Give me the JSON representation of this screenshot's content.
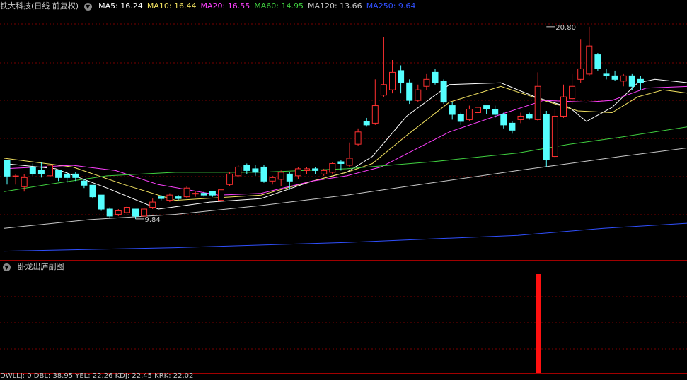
{
  "header": {
    "stock_title": "铁大科技(日线 前复权)",
    "ma": [
      {
        "label": "MA5: ",
        "value": "16.24",
        "color": "#ffffff"
      },
      {
        "label": "MA10: ",
        "value": "16.44",
        "color": "#f0e060"
      },
      {
        "label": "MA20: ",
        "value": "16.55",
        "color": "#ff40ff"
      },
      {
        "label": "MA60: ",
        "value": "14.95",
        "color": "#40d040"
      },
      {
        "label": "MA120: ",
        "value": "13.66",
        "color": "#c8c8c8"
      },
      {
        "label": "MA250: ",
        "value": "9.64",
        "color": "#3050ff"
      }
    ]
  },
  "sub_panel": {
    "title": "卧龙出庐副图",
    "bottom_text": "DWLLJ: 0  DBL: 38.95  YEL: 22.26  KDJ: 22.45  KRK: 22.02"
  },
  "colors": {
    "up": "#ff3030",
    "down": "#54ffff",
    "grid": "#7a0000",
    "signal": "#ff1010"
  },
  "chart_data": {
    "type": "candlestick",
    "price_range": [
      7.5,
      21.6
    ],
    "annotations": [
      {
        "text": "20.80",
        "value": 20.8,
        "bar": 63
      },
      {
        "text": "9.84",
        "value": 9.84,
        "bar": 15
      }
    ],
    "candles": [
      [
        13.2,
        12.28,
        13.2,
        11.8
      ],
      [
        12.28,
        12.29,
        12.4,
        11.8
      ],
      [
        11.68,
        12.2,
        12.4,
        11.4
      ],
      [
        12.8,
        12.4,
        13.0,
        12.3
      ],
      [
        12.6,
        12.4,
        13.1,
        12.2
      ],
      [
        12.3,
        12.9,
        12.9,
        12.2
      ],
      [
        12.6,
        12.2,
        12.6,
        12.0
      ],
      [
        12.4,
        12.2,
        12.5,
        11.9
      ],
      [
        12.4,
        12.2,
        12.5,
        12.0
      ],
      [
        12.0,
        11.76,
        12.1,
        11.6
      ],
      [
        11.76,
        11.1,
        11.76,
        11.0
      ],
      [
        11.2,
        10.4,
        11.2,
        10.3
      ],
      [
        10.4,
        10.0,
        10.5,
        9.9
      ],
      [
        10.1,
        10.3,
        10.4,
        10.0
      ],
      [
        10.2,
        10.5,
        10.6,
        10.1
      ],
      [
        10.4,
        10.0,
        10.4,
        9.84
      ],
      [
        10.0,
        10.4,
        10.5,
        10.0
      ],
      [
        10.5,
        10.8,
        11.0,
        10.4
      ],
      [
        11.1,
        11.0,
        11.2,
        10.9
      ],
      [
        10.9,
        11.2,
        11.3,
        10.8
      ],
      [
        11.1,
        11.0,
        11.2,
        10.9
      ],
      [
        11.1,
        11.6,
        11.7,
        11.0
      ],
      [
        11.3,
        11.3,
        11.4,
        11.1
      ],
      [
        11.3,
        11.2,
        11.4,
        11.1
      ],
      [
        11.4,
        11.2,
        11.4,
        11.1
      ],
      [
        10.9,
        11.5,
        11.6,
        10.8
      ],
      [
        11.8,
        12.4,
        12.5,
        11.7
      ],
      [
        12.3,
        12.8,
        12.9,
        12.2
      ],
      [
        12.9,
        12.6,
        13.0,
        12.4
      ],
      [
        12.7,
        12.5,
        12.9,
        12.3
      ],
      [
        12.8,
        12.0,
        12.9,
        11.9
      ],
      [
        12.0,
        12.2,
        12.3,
        11.8
      ],
      [
        12.1,
        12.5,
        12.6,
        11.7
      ],
      [
        12.4,
        12.0,
        12.5,
        11.5
      ],
      [
        12.3,
        12.7,
        12.8,
        12.1
      ],
      [
        12.6,
        12.7,
        12.8,
        12.4
      ],
      [
        12.7,
        12.6,
        12.8,
        12.4
      ],
      [
        12.4,
        12.6,
        12.7,
        12.3
      ],
      [
        12.5,
        13.0,
        13.1,
        12.4
      ],
      [
        13.1,
        13.0,
        13.2,
        12.6
      ],
      [
        12.9,
        13.3,
        14.2,
        12.8
      ],
      [
        14.1,
        14.8,
        15.0,
        14.0
      ],
      [
        15.4,
        15.2,
        15.6,
        15.1
      ],
      [
        15.3,
        16.3,
        17.8,
        15.2
      ],
      [
        16.9,
        17.5,
        20.2,
        16.8
      ],
      [
        17.2,
        18.2,
        18.9,
        17.0
      ],
      [
        18.3,
        17.6,
        18.6,
        17.0
      ],
      [
        17.6,
        16.6,
        17.8,
        16.4
      ],
      [
        16.6,
        17.2,
        17.5,
        16.5
      ],
      [
        17.4,
        17.8,
        18.1,
        17.2
      ],
      [
        18.2,
        17.6,
        18.4,
        17.5
      ],
      [
        17.7,
        16.5,
        17.8,
        16.4
      ],
      [
        16.3,
        15.8,
        16.5,
        15.5
      ],
      [
        15.8,
        15.4,
        15.9,
        15.2
      ],
      [
        15.5,
        16.1,
        16.3,
        15.4
      ],
      [
        15.9,
        16.2,
        16.3,
        15.7
      ],
      [
        16.3,
        16.1,
        16.3,
        15.8
      ],
      [
        16.1,
        15.8,
        16.3,
        15.6
      ],
      [
        15.8,
        15.2,
        15.9,
        15.0
      ],
      [
        15.3,
        14.9,
        15.4,
        14.7
      ],
      [
        15.5,
        15.7,
        15.9,
        15.3
      ],
      [
        15.8,
        15.6,
        15.9,
        15.5
      ],
      [
        15.5,
        17.4,
        18.2,
        15.4
      ],
      [
        15.8,
        13.2,
        16.0,
        12.8
      ],
      [
        13.4,
        15.7,
        16.1,
        13.3
      ],
      [
        15.7,
        16.8,
        17.5,
        15.6
      ],
      [
        16.7,
        17.4,
        18.1,
        16.4
      ],
      [
        17.8,
        18.4,
        20.1,
        17.6
      ],
      [
        18.1,
        19.7,
        20.8,
        18.0
      ],
      [
        19.2,
        18.4,
        19.3,
        18.3
      ],
      [
        18.1,
        18.0,
        18.4,
        17.8
      ],
      [
        18.0,
        17.8,
        18.3,
        17.7
      ],
      [
        17.7,
        18.0,
        18.1,
        17.4
      ],
      [
        18.0,
        17.4,
        18.1,
        17.2
      ],
      [
        17.8,
        17.6,
        18.0,
        17.2
      ]
    ],
    "moving_averages": [
      {
        "name": "MA5",
        "color": "#ffffff",
        "points": [
          [
            0,
            13.0
          ],
          [
            6,
            12.7
          ],
          [
            12,
            11.6
          ],
          [
            18,
            10.4
          ],
          [
            24,
            10.8
          ],
          [
            30,
            11.0
          ],
          [
            36,
            12.0
          ],
          [
            40,
            12.5
          ],
          [
            43,
            13.4
          ],
          [
            47,
            15.7
          ],
          [
            52,
            17.5
          ],
          [
            58,
            17.6
          ],
          [
            62,
            16.8
          ],
          [
            66,
            16.2
          ],
          [
            68,
            15.4
          ],
          [
            71,
            16.2
          ],
          [
            74,
            17.6
          ],
          [
            76,
            17.8
          ],
          [
            80,
            17.6
          ]
        ]
      },
      {
        "name": "MA10",
        "color": "#f0e060",
        "points": [
          [
            0,
            13.3
          ],
          [
            8,
            12.8
          ],
          [
            14,
            11.8
          ],
          [
            20,
            10.9
          ],
          [
            30,
            11.2
          ],
          [
            36,
            12.0
          ],
          [
            40,
            12.5
          ],
          [
            43,
            13.0
          ],
          [
            47,
            14.6
          ],
          [
            52,
            16.5
          ],
          [
            58,
            17.4
          ],
          [
            63,
            16.6
          ],
          [
            67,
            16.0
          ],
          [
            71,
            15.9
          ],
          [
            74,
            16.8
          ],
          [
            77,
            17.2
          ],
          [
            80,
            17.0
          ]
        ]
      },
      {
        "name": "MA20",
        "color": "#ff40ff",
        "points": [
          [
            0,
            12.7
          ],
          [
            8,
            12.9
          ],
          [
            13,
            12.6
          ],
          [
            18,
            11.8
          ],
          [
            25,
            11.2
          ],
          [
            30,
            11.3
          ],
          [
            36,
            12.0
          ],
          [
            40,
            12.3
          ],
          [
            44,
            12.8
          ],
          [
            48,
            13.8
          ],
          [
            52,
            14.8
          ],
          [
            58,
            15.8
          ],
          [
            63,
            16.6
          ],
          [
            68,
            16.5
          ],
          [
            71,
            16.6
          ],
          [
            75,
            17.3
          ],
          [
            80,
            17.4
          ]
        ]
      },
      {
        "name": "MA60",
        "color": "#40d040",
        "points": [
          [
            0,
            11.4
          ],
          [
            5,
            11.8
          ],
          [
            12,
            12.3
          ],
          [
            20,
            12.5
          ],
          [
            30,
            12.5
          ],
          [
            40,
            12.7
          ],
          [
            50,
            13.1
          ],
          [
            60,
            13.6
          ],
          [
            66,
            14.1
          ],
          [
            72,
            14.5
          ],
          [
            80,
            15.1
          ]
        ]
      },
      {
        "name": "MA120",
        "color": "#c8c8c8",
        "points": [
          [
            0,
            9.3
          ],
          [
            10,
            9.8
          ],
          [
            20,
            10.1
          ],
          [
            30,
            10.6
          ],
          [
            40,
            11.2
          ],
          [
            50,
            11.9
          ],
          [
            60,
            12.6
          ],
          [
            66,
            13.0
          ],
          [
            72,
            13.4
          ],
          [
            80,
            13.9
          ]
        ]
      },
      {
        "name": "MA250",
        "color": "#3050ff",
        "points": [
          [
            0,
            8.0
          ],
          [
            20,
            8.2
          ],
          [
            40,
            8.5
          ],
          [
            60,
            8.9
          ],
          [
            70,
            9.3
          ],
          [
            80,
            9.6
          ]
        ]
      }
    ],
    "signal": {
      "bar": 62,
      "level": 1.0
    }
  }
}
